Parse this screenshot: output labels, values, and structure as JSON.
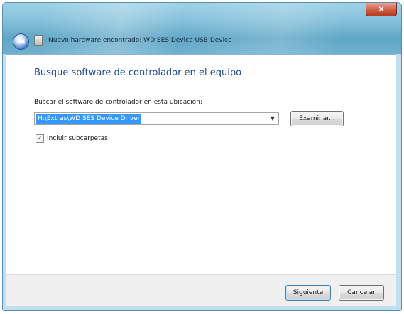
{
  "window": {
    "title": "Nuevo hardware encontrado: WD SES Device USB Device",
    "close_glyph": "✕"
  },
  "nav": {
    "back_glyph": "◄"
  },
  "content": {
    "heading": "Busque software de controlador en el equipo",
    "location_label": "Buscar el software de controlador en esta ubicación:",
    "location_value": "H:\\Extras\\WD SES Device Driver",
    "browse_label": "Examinar...",
    "include_subfolders_label": "Incluir subcarpetas",
    "include_subfolders_checked": true,
    "check_glyph": "✓"
  },
  "footer": {
    "next_label": "Siguiente",
    "cancel_label": "Cancelar"
  },
  "colors": {
    "heading": "#1f4a91",
    "selection": "#3399ff",
    "titlebar": "#85c1da"
  },
  "icons": {
    "back": "back-arrow-icon",
    "device": "device-icon",
    "close": "close-icon",
    "dropdown": "chevron-down-icon",
    "checkbox": "check-icon"
  }
}
